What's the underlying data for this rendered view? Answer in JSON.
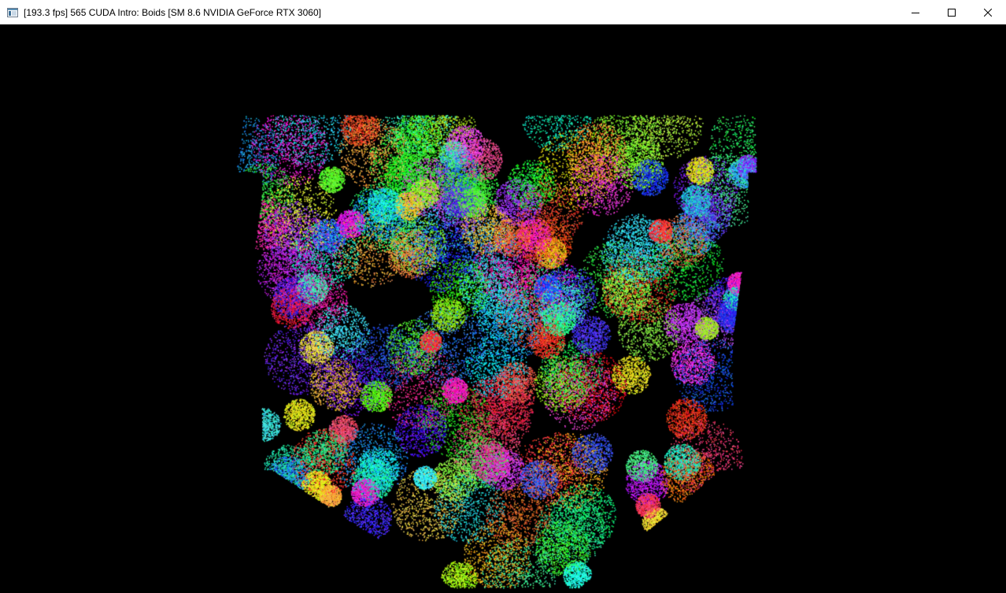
{
  "window": {
    "title": "[193.3 fps] 565 CUDA Intro: Boids [SM 8.6 NVIDIA GeForce RTX 3060]",
    "icon": "app-window-icon",
    "controls": {
      "minimize": "minimize-icon",
      "maximize": "maximize-icon",
      "close": "close-icon"
    }
  },
  "viewport": {
    "background": "#000000",
    "content": "boids-point-cloud"
  }
}
